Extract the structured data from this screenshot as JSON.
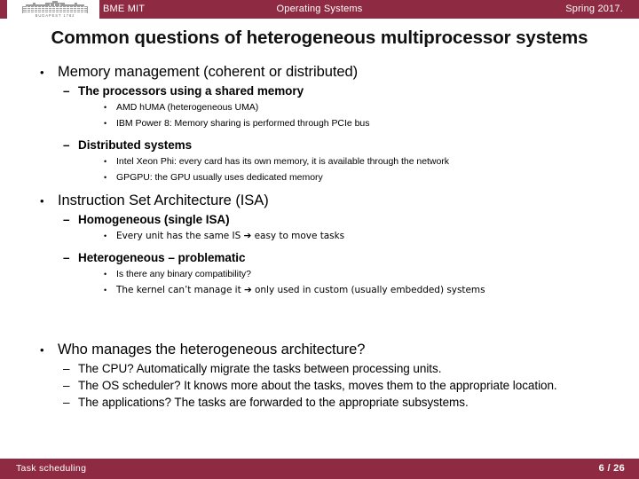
{
  "theme": {
    "accent": "#8e2a41",
    "text": "#000000",
    "background": "#ffffff"
  },
  "header": {
    "logo_icon": "university-building-icon",
    "logo_caption": "BUDAPEST 1782",
    "left_label": "BME MIT",
    "center_label": "Operating Systems",
    "right_label": "Spring 2017."
  },
  "title": "Common questions of heterogeneous multiprocessor systems",
  "content": [
    {
      "level": 1,
      "marker": "•",
      "text": "Memory management (coherent or distributed)"
    },
    {
      "level": 2,
      "marker": "–",
      "text": "The processors using a shared memory"
    },
    {
      "level": 3,
      "marker": "•",
      "text": "AMD hUMA (heterogeneous UMA)"
    },
    {
      "level": 3,
      "marker": "•",
      "text": "IBM Power 8: Memory sharing is performed through PCIe bus"
    },
    {
      "level": 2,
      "marker": "–",
      "text": "Distributed systems"
    },
    {
      "level": 3,
      "marker": "•",
      "text": "Intel Xeon Phi: every card has its own memory, it is available through the network"
    },
    {
      "level": 3,
      "marker": "•",
      "text": "GPGPU: the GPU usually uses dedicated memory"
    },
    {
      "level": 1,
      "marker": "•",
      "text": "Instruction Set Architecture (ISA)"
    },
    {
      "level": 2,
      "marker": "–",
      "text": "Homogeneous (single ISA)"
    },
    {
      "level": 3,
      "marker": "•",
      "text": "Every unit has the same IS ➔ easy to move tasks"
    },
    {
      "level": 2,
      "marker": "–",
      "text": "Heterogeneous – problematic"
    },
    {
      "level": 3,
      "marker": "•",
      "text": "Is there any binary compatibility?"
    },
    {
      "level": 3,
      "marker": "•",
      "text": "The kernel can’t manage it ➔ only used in custom (usually embedded) systems"
    },
    {
      "level": 1,
      "marker": "•",
      "text": "Who manages the heterogeneous architecture?"
    },
    {
      "level": 2,
      "marker": "–",
      "text": "The CPU? Automatically migrate the tasks between processing units.",
      "bold": false
    },
    {
      "level": 2,
      "marker": "–",
      "text": "The OS scheduler? It knows more about the tasks, moves them to the appropriate location.",
      "bold": false
    },
    {
      "level": 2,
      "marker": "–",
      "text": "The applications? The tasks are forwarded to the appropriate subsystems.",
      "bold": false
    }
  ],
  "footer": {
    "left_label": "Task scheduling",
    "page_label": "6 / 26"
  }
}
